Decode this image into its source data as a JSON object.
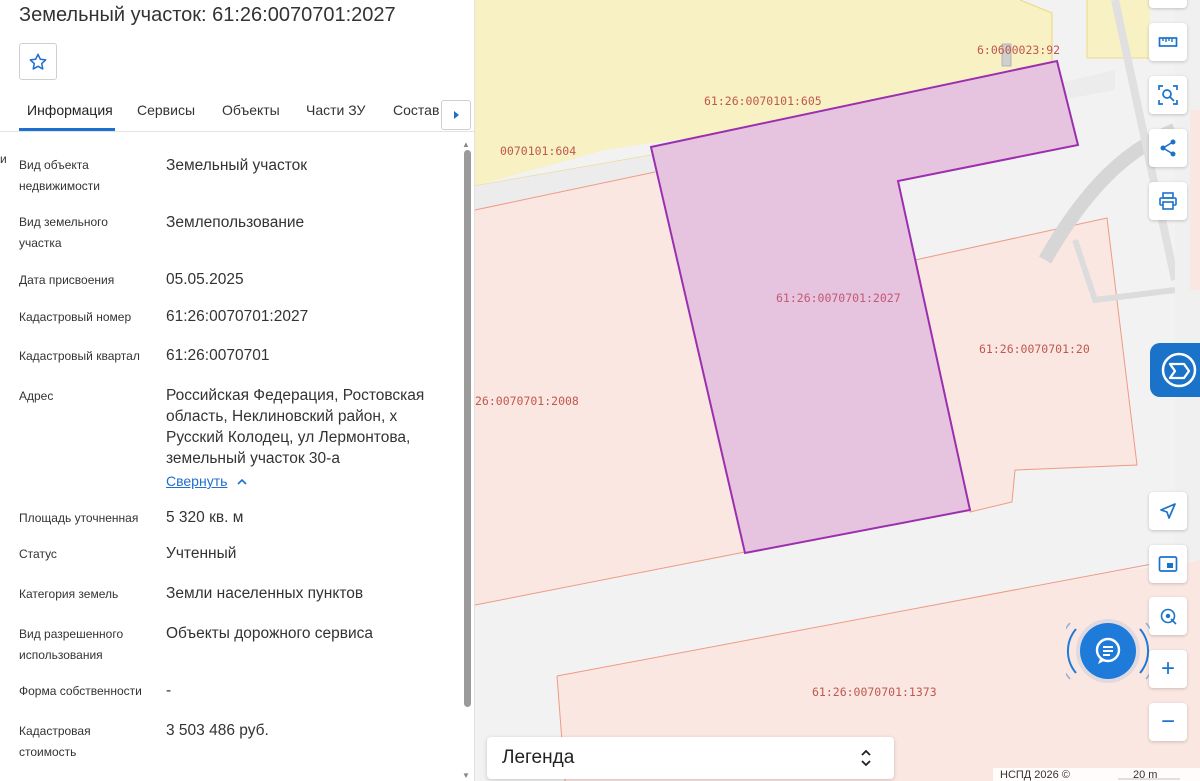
{
  "panel": {
    "title": "Земельный участок: 61:26:0070701:2027",
    "left_edge_fragment": "и",
    "tabs": [
      {
        "label": "Информация",
        "active": true
      },
      {
        "label": "Сервисы",
        "active": false
      },
      {
        "label": "Объекты",
        "active": false
      },
      {
        "label": "Части ЗУ",
        "active": false
      },
      {
        "label": "Состав",
        "active": false
      }
    ],
    "rows": [
      {
        "label": "Вид объекта недвижимости",
        "value": "Земельный участок"
      },
      {
        "label": "Вид земельного участка",
        "value": "Землепользование"
      },
      {
        "label": "Дата присвоения",
        "value": "05.05.2025"
      },
      {
        "label": "Кадастровый номер",
        "value": "61:26:0070701:2027"
      },
      {
        "label": "Кадастровый квартал",
        "value": "61:26:0070701"
      },
      {
        "label": "Адрес",
        "value": "Российская Федерация, Ростовская область, Неклиновский район, х Русский Колодец, ул Лермонтова, земельный участок 30-а"
      },
      {
        "label": "Площадь уточненная",
        "value": "5 320 кв. м"
      },
      {
        "label": "Статус",
        "value": "Учтенный"
      },
      {
        "label": "Категория земель",
        "value": "Земли населенных пунктов"
      },
      {
        "label": "Вид разрешенного использования",
        "value": "Объекты дорожного сервиса"
      },
      {
        "label": "Форма собственности",
        "value": "-"
      },
      {
        "label": "Кадастровая стоимость",
        "value": "3 503 486 руб."
      }
    ],
    "collapse_link": "Свернуть"
  },
  "map": {
    "parcel_labels": {
      "top_right": "6:0600023:92",
      "upper_605": "61:26:0070101:605",
      "left_604": "0070101:604",
      "selected": "61:26:0070701:2027",
      "right_20": "61:26:0070701:20",
      "left_2008": "26:0070701:2008",
      "bottom_1373": "61:26:0070701:1373"
    },
    "colors": {
      "yellow_zone": "#f8f1c4",
      "pink_zone": "#fbe7e2",
      "selected_fill": "#e6c3de",
      "selected_stroke": "#9b2fae",
      "parcel_stroke": "#ee9a86",
      "accent": "#1a73c9"
    }
  },
  "controls": {
    "icons": [
      "ruler-icon",
      "area-select-icon",
      "share-icon",
      "print-icon",
      "navigate-icon",
      "minimap-icon",
      "locate-icon",
      "zoom-in-icon",
      "zoom-out-icon"
    ],
    "zoom_in": "+",
    "zoom_out": "−"
  },
  "legend": {
    "title": "Легенда"
  },
  "footer": {
    "copyright": "НСПД 2026 ©",
    "scale": "20 m"
  }
}
